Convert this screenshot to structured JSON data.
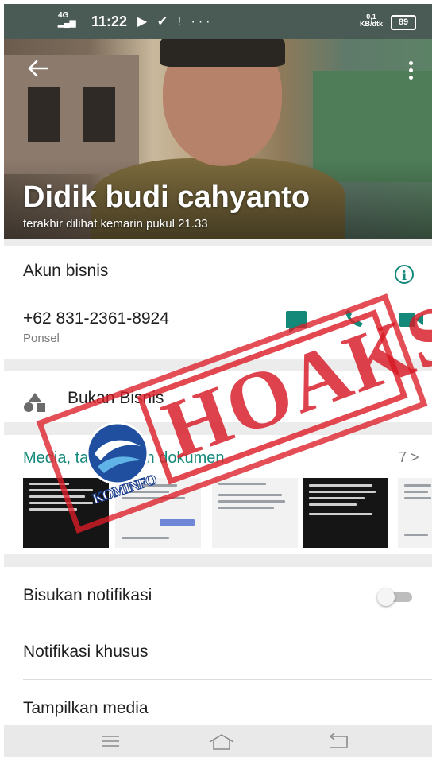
{
  "status_bar": {
    "network": "4G",
    "time": "11:22",
    "icons": "▶ ✔ ! ···",
    "speed_value": "0,1",
    "speed_unit": "KB/dtk",
    "battery": "89"
  },
  "profile": {
    "name": "Didik budi cahyanto",
    "last_seen": "terakhir dilihat kemarin pukul 21.33"
  },
  "business": {
    "label": "Akun bisnis"
  },
  "phone": {
    "number": "+62 831-2361-8924",
    "type": "Ponsel"
  },
  "category": {
    "label": "Bukan Bisnis"
  },
  "media": {
    "title": "Media, tautan, dan dokumen",
    "count": "7 >"
  },
  "settings": {
    "mute_label": "Bisukan notifikasi",
    "mute_on": false,
    "custom_label": "Notifikasi khusus",
    "visibility_label": "Tampilkan media"
  },
  "overlay": {
    "stamp_text": "HOAKS",
    "logo_text": "KOMINFO"
  },
  "colors": {
    "accent": "#14897a",
    "stamp": "#d71824"
  }
}
